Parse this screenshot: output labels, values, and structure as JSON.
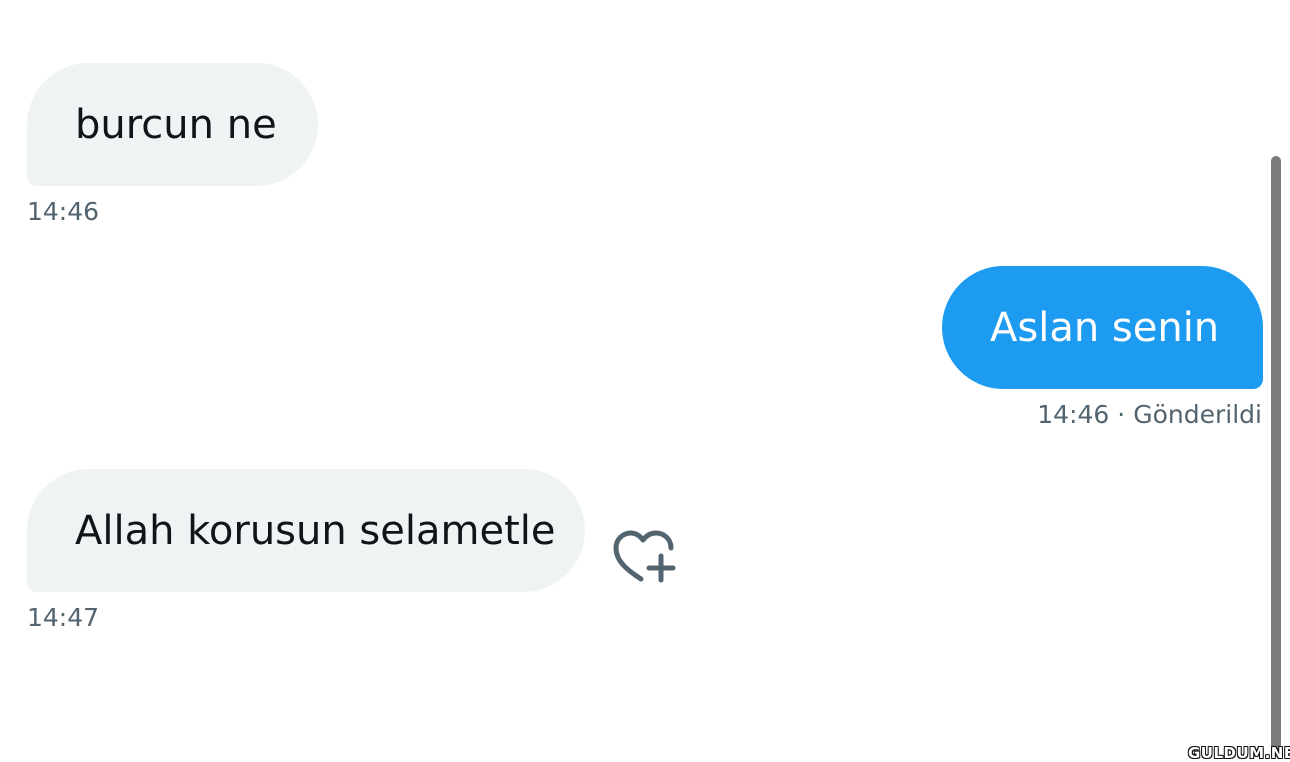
{
  "messages": [
    {
      "text": "burcun ne",
      "time": "14:46",
      "direction": "incoming"
    },
    {
      "text": "Aslan senin",
      "time": "14:46",
      "status": "Gönderildi",
      "separator": "·",
      "direction": "outgoing"
    },
    {
      "text": "Allah korusun selametle",
      "time": "14:47",
      "direction": "incoming"
    }
  ],
  "reaction_button": {
    "icon": "heart-plus-icon"
  },
  "watermark": "GULDUM.NET",
  "colors": {
    "incoming_bubble": "#eff3f4",
    "outgoing_bubble": "#1d9bf0",
    "meta_text": "#536471",
    "scrollbar": "#7b7b7b"
  }
}
